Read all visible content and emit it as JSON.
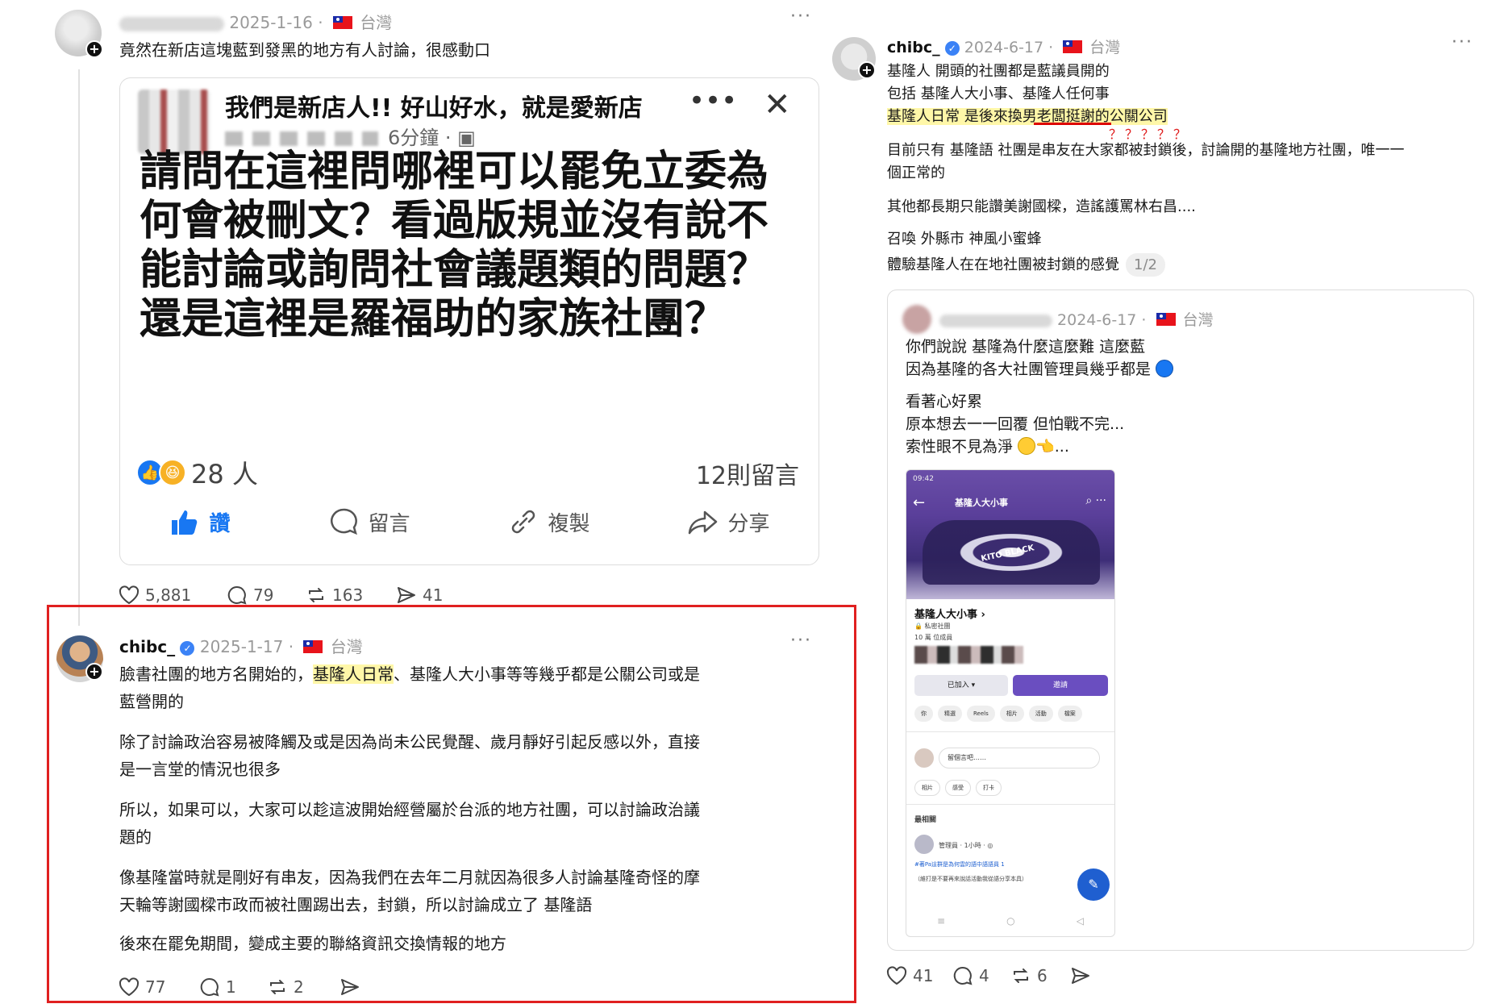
{
  "post1": {
    "date": "2025-1-16",
    "location": "台灣",
    "text": "竟然在新店這塊藍到發黑的地方有人討論，很感動口",
    "more": "···",
    "stats": {
      "likes": "5,881",
      "replies": "79",
      "reposts": "163",
      "shares": "41"
    }
  },
  "fb_card": {
    "group_name": "我們是新店人!! 好山好水，就是愛新店",
    "time": "6分鐘 · ",
    "more": "•••",
    "close": "✕",
    "body": "請問在這裡問哪裡可以罷免立委為何會被刪文？看過版規並沒有說不能討論或詢問社會議題類的問題？還是這裡是羅福助的家族社團？",
    "reaction_count": "28 人",
    "comment_count": "12則留言",
    "actions": [
      "讚",
      "留言",
      "複製",
      "分享"
    ]
  },
  "post2": {
    "username": "chibc_",
    "date": "2025-1-17",
    "location": "台灣",
    "more": "···",
    "line1_pre": "臉書社團的地方名開始的，",
    "line1_hl": "基隆人日常",
    "line1_post": "、基隆人大小事等等幾乎都是公關公司或是",
    "line2": "藍營開的",
    "para2_l1": "除了討論政治容易被降觸及或是因為尚未公民覺醒、歲月靜好引起反感以外，直接",
    "para2_l2": "是一言堂的情況也很多",
    "para3_l1": "所以，如果可以，大家可以趁這波開始經營屬於台派的地方社團，可以討論政治議",
    "para3_l2": "題的",
    "para4_l1": "像基隆當時就是剛好有串友，因為我們在去年二月就因為很多人討論基隆奇怪的摩",
    "para4_l2": "天輪等謝國樑市政而被社團踢出去，封鎖，所以討論成立了 基隆語",
    "para5": "後來在罷免期間，變成主要的聯絡資訊交換情報的地方",
    "stats": {
      "likes": "77",
      "replies": "1",
      "reposts": "2"
    }
  },
  "post3": {
    "username": "chibc_",
    "date": "2024-6-17",
    "location": "台灣",
    "more": "···",
    "l1": "基隆人 開頭的社團都是藍議員開的",
    "l2": "包括 基隆人大小事、基隆人任何事",
    "l3_pre": "基隆人日常 是後來換",
    "l3_mid": "男老闆挺謝",
    "l3_post": "的公關公司",
    "qmarks": "？？？？？",
    "l4": "目前只有 基隆語 社團是串友在大家都被封鎖後，討論開的基隆地方社團，唯一一",
    "l5": "個正常的",
    "l6": "其他都長期只能讚美謝國樑，造謠護罵林右昌....",
    "l7": "召喚 外縣市 神風小蜜蜂",
    "l8": "體驗基隆人在在地社團被封鎖的感覺",
    "page": "1/2",
    "stats": {
      "likes": "41",
      "replies": "4",
      "reposts": "6"
    }
  },
  "quote": {
    "date": "2024-6-17",
    "location": "台灣",
    "l1": "你們說說 基隆為什麼這麼難 這麼藍",
    "l2": "因為基隆的各大社團管理員幾乎都是",
    "l3": "看著心好累",
    "l4": "原本想去一一回覆 但怕戰不完...",
    "l5": "索性眼不見為淨",
    "l5_tail": "...",
    "phone": {
      "status": "09:42",
      "header_title": "基隆人大小事",
      "banner_text": "KITO BLACK",
      "group_name": "基隆人大小事 ›",
      "group_type": "私密社團",
      "members": "10 萬 位成員",
      "joined_btn": "已加入 ▾",
      "invite_btn": "邀請",
      "chips": [
        "你",
        "精選",
        "Reels",
        "相片",
        "活動",
        "檔案"
      ],
      "compose": "留個言吧……",
      "row3": [
        "相片",
        "感受",
        "打卡"
      ],
      "section": "最相關",
      "post_meta": "管理員 · 1小時 · ◎",
      "post_link": "#著Pa這群是為何雲的語中語語員 1",
      "post_note": "（維打是不要再來說話活動我從語分享本具）"
    }
  }
}
